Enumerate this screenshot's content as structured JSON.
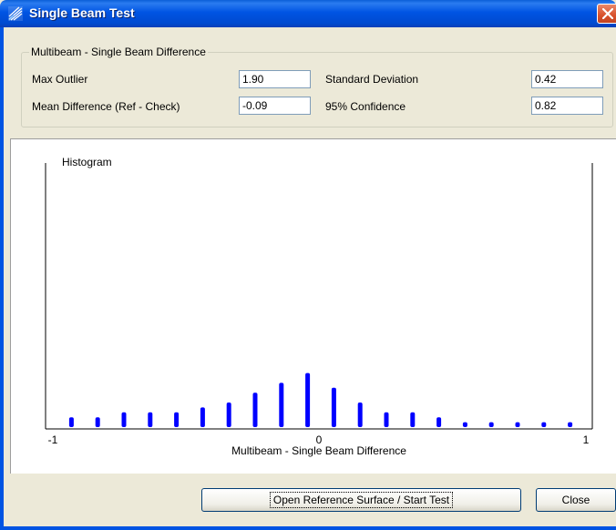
{
  "window": {
    "title": "Single Beam Test",
    "icon": "app-icon",
    "close_icon": "close-icon"
  },
  "group": {
    "title": "Multibeam - Single Beam Difference",
    "max_outlier_label": "Max Outlier",
    "max_outlier_value": "1.90",
    "mean_diff_label": "Mean Difference (Ref - Check)",
    "mean_diff_value": "-0.09",
    "std_dev_label": "Standard Deviation",
    "std_dev_value": "0.42",
    "confidence_label": "95% Confidence",
    "confidence_value": "0.82"
  },
  "chart_data": {
    "type": "bar",
    "title": "Histogram",
    "xlabel": "Multibeam - Single Beam Difference",
    "ylabel": "",
    "xlim": [
      -1,
      1
    ],
    "tick_labels": [
      "-1",
      "0",
      "1"
    ],
    "bar_color": "#0000ff",
    "x": [
      -0.95,
      -0.85,
      -0.75,
      -0.65,
      -0.55,
      -0.45,
      -0.35,
      -0.25,
      -0.15,
      -0.05,
      0.05,
      0.15,
      0.25,
      0.35,
      0.45,
      0.55,
      0.65,
      0.75,
      0.85,
      0.95
    ],
    "values": [
      2,
      2,
      3,
      3,
      3,
      4,
      5,
      7,
      9,
      11,
      8,
      5,
      3,
      3,
      2,
      1,
      1,
      1,
      1,
      1
    ]
  },
  "buttons": {
    "start_label": "Open Reference Surface / Start Test",
    "close_label": "Close"
  }
}
